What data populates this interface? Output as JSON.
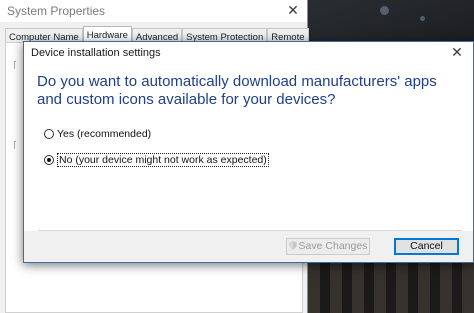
{
  "system_properties": {
    "title": "System Properties",
    "tabs": [
      {
        "label": "Computer Name",
        "active": false
      },
      {
        "label": "Hardware",
        "active": true
      },
      {
        "label": "Advanced",
        "active": false
      },
      {
        "label": "System Protection",
        "active": false
      },
      {
        "label": "Remote",
        "active": false
      }
    ]
  },
  "dialog": {
    "title": "Device installation settings",
    "question": "Do you want to automatically download manufacturers' apps and custom icons available for your devices?",
    "options": [
      {
        "label": "Yes (recommended)",
        "checked": false
      },
      {
        "label": "No (your device might not work as expected)",
        "checked": true
      }
    ],
    "save_button": "Save Changes",
    "cancel_button": "Cancel"
  },
  "colors": {
    "question_text": "#1e3f8c",
    "primary_border": "#0078d7"
  },
  "icons": {
    "close": "close-icon",
    "shield": "uac-shield-icon"
  }
}
